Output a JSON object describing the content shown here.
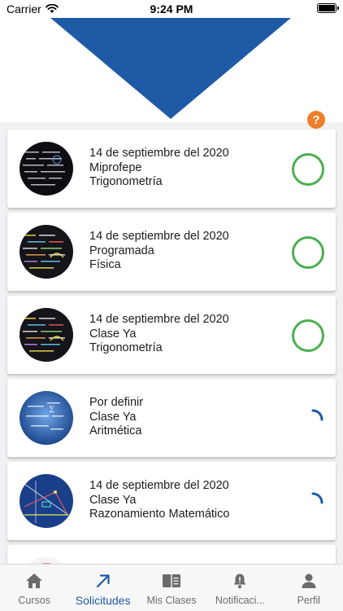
{
  "status_bar": {
    "carrier": "Carrier",
    "time": "9:24 PM"
  },
  "colors": {
    "brand_blue": "#1f5aa6",
    "accent_orange": "#f07d2a",
    "status_green": "#4caf50"
  },
  "header": {
    "help_label": "?"
  },
  "requests": [
    {
      "date": "14 de septiembre del 2020",
      "provider": "Miprofepe",
      "subject": "Trigonometría",
      "status": "confirmed",
      "thumbnail": "dark-math-blackboard-icon"
    },
    {
      "date": "14 de septiembre del 2020",
      "provider": "Programada",
      "subject": "Física",
      "status": "confirmed",
      "thumbnail": "colorful-formulas-icon"
    },
    {
      "date": "14 de septiembre del 2020",
      "provider": "Clase Ya",
      "subject": "Trigonometría",
      "status": "confirmed",
      "thumbnail": "colorful-formulas-icon"
    },
    {
      "date": "Por definir",
      "provider": "Clase Ya",
      "subject": "Aritmética",
      "status": "pending",
      "thumbnail": "blue-equations-icon"
    },
    {
      "date": "14 de septiembre del 2020",
      "provider": "Clase Ya",
      "subject": "Razonamiento Matemático",
      "status": "pending",
      "thumbnail": "geometry-diagram-icon"
    }
  ],
  "tabs": [
    {
      "label": "Cursos",
      "icon": "home-icon"
    },
    {
      "label": "Solicitudes",
      "icon": "arrow-up-right-icon",
      "active": true
    },
    {
      "label": "Mis Clases",
      "icon": "book-icon"
    },
    {
      "label": "Notificaci...",
      "icon": "bell-icon"
    },
    {
      "label": "Perfil",
      "icon": "person-icon"
    }
  ]
}
